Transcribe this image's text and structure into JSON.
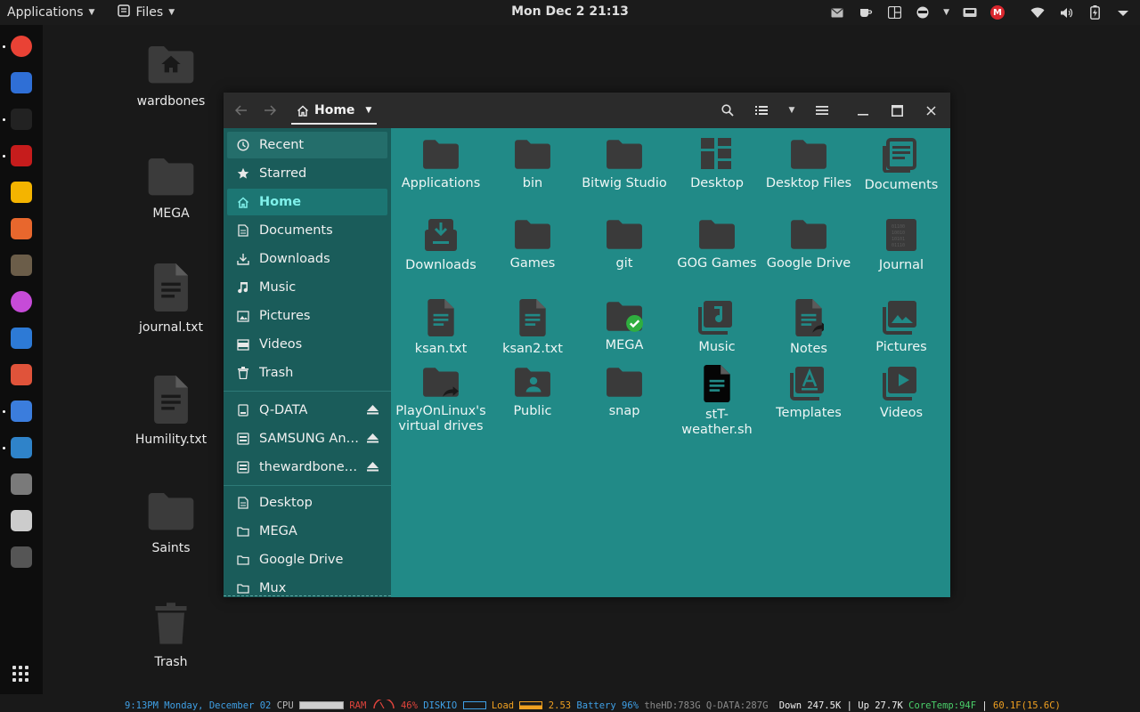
{
  "topbar": {
    "applications_label": "Applications",
    "files_label": "Files",
    "clock": "Mon Dec 2  21:13"
  },
  "dock": {
    "apps": [
      {
        "name": "chrome",
        "color": "#e94235"
      },
      {
        "name": "thunderbird",
        "color": "#2f6fd6"
      },
      {
        "name": "amazon",
        "color": "#222222"
      },
      {
        "name": "bible",
        "color": "#c61c1c"
      },
      {
        "name": "keep",
        "color": "#f4b400"
      },
      {
        "name": "calculator",
        "color": "#e8672d"
      },
      {
        "name": "gimp",
        "color": "#6b5d49"
      },
      {
        "name": "firefox-nightly",
        "color": "#c64bd8"
      },
      {
        "name": "software",
        "color": "#2d7ad6"
      },
      {
        "name": "git",
        "color": "#e0533a"
      },
      {
        "name": "notes",
        "color": "#3b7ddd"
      },
      {
        "name": "files",
        "color": "#2f83c9"
      },
      {
        "name": "radio",
        "color": "#7a7a7a"
      },
      {
        "name": "tablet",
        "color": "#cccccc"
      },
      {
        "name": "trash",
        "color": "#555555"
      }
    ]
  },
  "desktop": {
    "items": [
      {
        "label": "wardbones",
        "icon": "home-folder-icon"
      },
      {
        "label": "MEGA",
        "icon": "folder-icon"
      },
      {
        "label": "journal.txt",
        "icon": "text-file-icon"
      },
      {
        "label": "Humility.txt",
        "icon": "text-file-icon"
      },
      {
        "label": "Saints",
        "icon": "folder-icon"
      },
      {
        "label": "Trash",
        "icon": "trash-icon"
      }
    ]
  },
  "window": {
    "path_label": "Home",
    "sidebar": {
      "places": [
        {
          "label": "Recent",
          "icon": "clock-icon"
        },
        {
          "label": "Starred",
          "icon": "star-icon"
        },
        {
          "label": "Home",
          "icon": "home-icon"
        },
        {
          "label": "Documents",
          "icon": "document-icon"
        },
        {
          "label": "Downloads",
          "icon": "download-icon"
        },
        {
          "label": "Music",
          "icon": "music-icon"
        },
        {
          "label": "Pictures",
          "icon": "image-icon"
        },
        {
          "label": "Videos",
          "icon": "video-icon"
        },
        {
          "label": "Trash",
          "icon": "trash-icon"
        }
      ],
      "devices": [
        {
          "label": "Q-DATA",
          "icon": "drive-icon"
        },
        {
          "label": "SAMSUNG An…",
          "icon": "harddisk-icon"
        },
        {
          "label": "thewardbone…",
          "icon": "harddisk-icon"
        }
      ],
      "bookmarks": [
        {
          "label": "Desktop",
          "icon": "document-icon"
        },
        {
          "label": "MEGA",
          "icon": "folder-icon"
        },
        {
          "label": "Google Drive",
          "icon": "folder-icon"
        },
        {
          "label": "Mux",
          "icon": "folder-icon"
        }
      ]
    },
    "files": [
      {
        "label": "Applications",
        "icon": "folder-icon"
      },
      {
        "label": "bin",
        "icon": "folder-icon"
      },
      {
        "label": "Bitwig Studio",
        "icon": "folder-icon"
      },
      {
        "label": "Desktop",
        "icon": "desktop-folder-icon"
      },
      {
        "label": "Desktop Files",
        "icon": "folder-icon"
      },
      {
        "label": "Documents",
        "icon": "documents-folder-icon"
      },
      {
        "label": "Downloads",
        "icon": "downloads-folder-icon"
      },
      {
        "label": "Games",
        "icon": "folder-icon"
      },
      {
        "label": "git",
        "icon": "folder-icon"
      },
      {
        "label": "GOG Games",
        "icon": "folder-icon"
      },
      {
        "label": "Google Drive",
        "icon": "folder-icon"
      },
      {
        "label": "Journal",
        "icon": "binary-file-icon"
      },
      {
        "label": "ksan.txt",
        "icon": "text-file-icon"
      },
      {
        "label": "ksan2.txt",
        "icon": "text-file-icon"
      },
      {
        "label": "MEGA",
        "icon": "synced-folder-icon"
      },
      {
        "label": "Music",
        "icon": "music-folder-icon"
      },
      {
        "label": "Notes",
        "icon": "text-link-icon"
      },
      {
        "label": "Pictures",
        "icon": "pictures-folder-icon"
      },
      {
        "label": "PlayOnLinux's virtual drives",
        "icon": "folder-link-icon"
      },
      {
        "label": "Public",
        "icon": "public-folder-icon"
      },
      {
        "label": "snap",
        "icon": "folder-icon"
      },
      {
        "label": "stT-weather.sh",
        "icon": "script-file-icon"
      },
      {
        "label": "Templates",
        "icon": "templates-folder-icon"
      },
      {
        "label": "Videos",
        "icon": "videos-folder-icon"
      }
    ]
  },
  "statusbar": {
    "time": "9:13PM Monday, December 02",
    "cpu_label": "CPU",
    "ram_label": "RAM",
    "ram_value": "46%",
    "diskio_label": "DISKIO",
    "load_label": "Load",
    "load_value": "2.53",
    "battery_label": "Battery",
    "battery_value": "96%",
    "thehd": "theHD:783G",
    "qdata": "Q-DATA:287G",
    "down": "Down 247.5K",
    "sep": "|",
    "up": "Up 27.7K",
    "coretemp": "CoreTemp:94F",
    "sep2": "|",
    "weather": "60.1F(15.6C)",
    "colors": {
      "time": "#3fa0e6",
      "gray": "#b8b8b8",
      "red": "#e0443c",
      "blue": "#3fa0e6",
      "orange": "#f0a020",
      "green": "#4ad06a",
      "white": "#f0f0f0"
    }
  }
}
